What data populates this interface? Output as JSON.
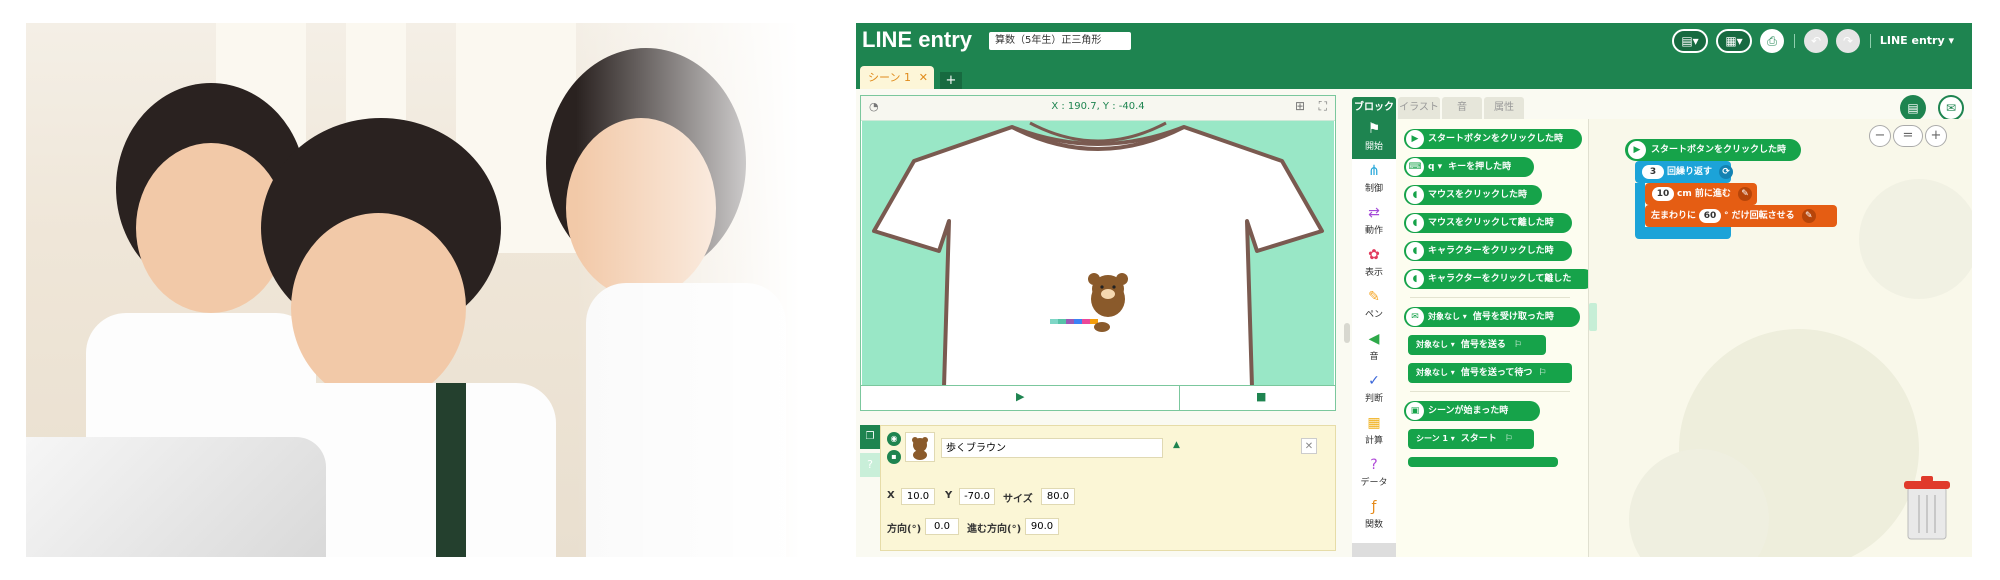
{
  "app": {
    "logo": "LINE entry",
    "project_name": "算数（5年生）正三角形",
    "user_menu": "LINE entry ▾",
    "colors": {
      "brand": "#1e8450",
      "start_block": "#16a34a",
      "repeat_block": "#1ca3d8",
      "move_block": "#e55d13"
    }
  },
  "toolbar": {
    "buttons": [
      {
        "name": "file-menu",
        "icon": "document-icon"
      },
      {
        "name": "save-menu",
        "icon": "save-icon"
      },
      {
        "name": "print",
        "icon": "printer-icon"
      },
      {
        "name": "undo",
        "icon": "undo-icon"
      },
      {
        "name": "redo",
        "icon": "redo-icon"
      }
    ]
  },
  "scene": {
    "tab_label": "シーン 1",
    "close": "✕",
    "add": "+"
  },
  "stage": {
    "coordinates": "X : 190.7, Y : -40.4"
  },
  "object": {
    "name": "歩くブラウン",
    "x_label": "X",
    "x": "10.0",
    "y_label": "Y",
    "y": "-70.0",
    "size_label": "サイズ",
    "size": "80.0",
    "dir_label": "方向(°)",
    "dir": "0.0",
    "move_dir_label": "進む方向(°)",
    "move_dir": "90.0"
  },
  "tabs": [
    "ブロック",
    "イラスト",
    "音",
    "属性"
  ],
  "categories": [
    {
      "label": "開始",
      "icon": "flag-icon"
    },
    {
      "label": "制御",
      "icon": "flow-icon"
    },
    {
      "label": "動作",
      "icon": "move-icon"
    },
    {
      "label": "表示",
      "icon": "looks-icon"
    },
    {
      "label": "ペン",
      "icon": "pen-icon"
    },
    {
      "label": "音",
      "icon": "speaker-icon"
    },
    {
      "label": "判断",
      "icon": "check-icon"
    },
    {
      "label": "計算",
      "icon": "calc-icon"
    },
    {
      "label": "データ",
      "icon": "question-icon"
    },
    {
      "label": "関数",
      "icon": "function-icon"
    }
  ],
  "palette": {
    "b1": "スタートボタンをクリックした時",
    "b2_key": "q ▾",
    "b2": "キーを押した時",
    "b3": "マウスをクリックした時",
    "b4": "マウスをクリックして離した時",
    "b5": "キャラクターをクリックした時",
    "b6": "キャラクターをクリックして離した",
    "b7_sel": "対象なし ▾",
    "b7": "信号を受け取った時",
    "b8_sel": "対象なし ▾",
    "b8": "信号を送る",
    "b9_sel": "対象なし ▾",
    "b9": "信号を送って待つ",
    "b10": "シーンが始まった時",
    "b11_sel": "シーン 1 ▾",
    "b11": "スタート"
  },
  "script": {
    "start": "スタートボタンをクリックした時",
    "repeat_count": "3",
    "repeat_text": "回繰り返す",
    "move_distance": "10",
    "move_text": "cm 前に進む",
    "turn_prefix": "左まわりに",
    "turn_angle": "60",
    "turn_text": "° だけ回転させる"
  },
  "zoom": {
    "out": "−",
    "reset": "=",
    "in": "+"
  }
}
